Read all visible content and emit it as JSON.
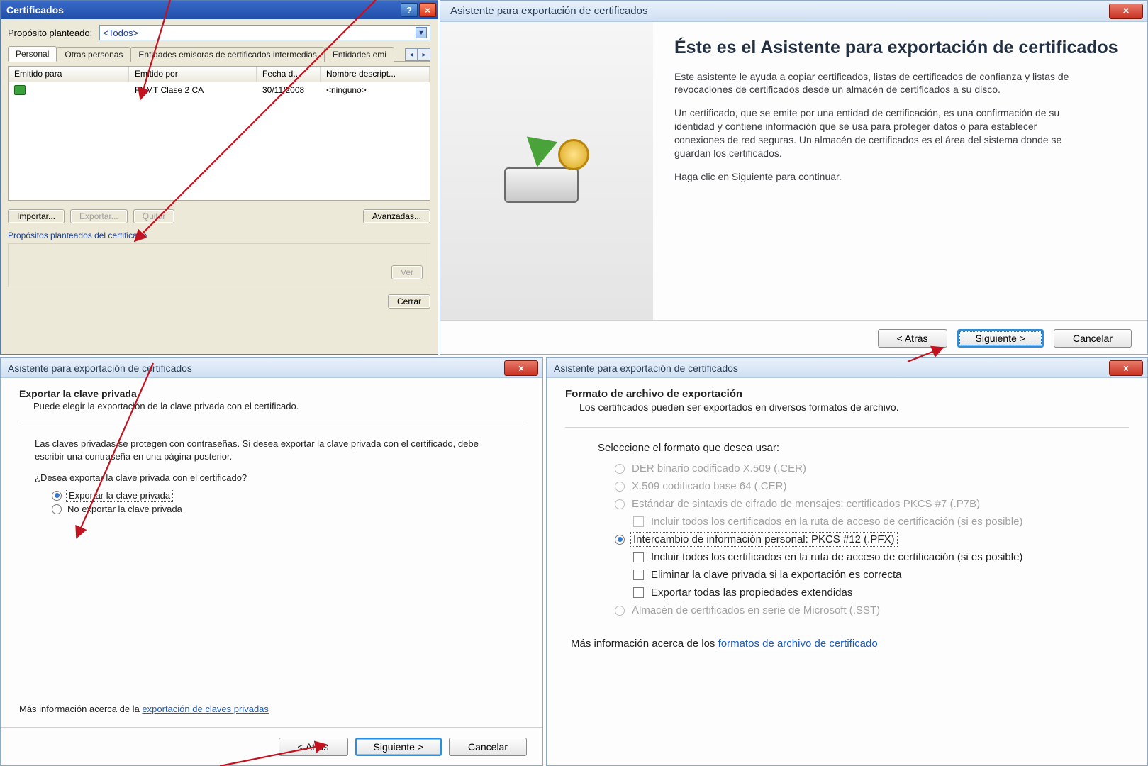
{
  "panel1": {
    "title": "Certificados",
    "purpose_label": "Propósito planteado:",
    "purpose_value": "<Todos>",
    "tabs": [
      "Personal",
      "Otras personas",
      "Entidades emisoras de certificados intermedias",
      "Entidades emi"
    ],
    "columns": [
      "Emitido para",
      "Emitido por",
      "Fecha d...",
      "Nombre descript..."
    ],
    "row": {
      "issued_to": "",
      "issued_by": "FNMT Clase 2 CA",
      "date": "30/11/2008",
      "friendly": "<ninguno>"
    },
    "btn_import": "Importar...",
    "btn_export": "Exportar...",
    "btn_remove": "Quitar",
    "btn_advanced": "Avanzadas...",
    "group_label": "Propósitos planteados del certificado",
    "btn_view": "Ver",
    "btn_close": "Cerrar"
  },
  "panel2": {
    "title": "Asistente para exportación de certificados",
    "heading": "Éste es el Asistente para exportación de certificados",
    "para1": "Este asistente le ayuda a copiar certificados, listas de certificados de confianza y listas de revocaciones de certificados desde un almacén de certificados a su disco.",
    "para2": "Un certificado, que se emite por una entidad de certificación, es una confirmación de su identidad y contiene información que se usa para proteger datos o para establecer conexiones de red seguras. Un almacén de certificados es el área del sistema donde se guardan los certificados.",
    "para3": "Haga clic en Siguiente para continuar.",
    "btn_back": "< Atrás",
    "btn_next": "Siguiente >",
    "btn_cancel": "Cancelar"
  },
  "panel3": {
    "title": "Asistente para exportación de certificados",
    "heading": "Exportar la clave privada",
    "sub": "Puede elegir la exportación de la clave privada con el certificado.",
    "para": "Las claves privadas se protegen con contraseñas. Si desea exportar la clave privada con el certificado, debe escribir una contraseña en una página posterior.",
    "question": "¿Desea exportar la clave privada con el certificado?",
    "opt_yes": "Exportar la clave privada",
    "opt_no": "No exportar la clave privada",
    "link_prefix": "Más información acerca de la ",
    "link_text": "exportación de claves privadas",
    "btn_back": "< Atrás",
    "btn_next": "Siguiente >",
    "btn_cancel": "Cancelar"
  },
  "panel4": {
    "title": "Asistente para exportación de certificados",
    "heading": "Formato de archivo de exportación",
    "sub": "Los certificados pueden ser exportados en diversos formatos de archivo.",
    "section": "Seleccione el formato que desea usar:",
    "opt_der": "DER binario codificado X.509 (.CER)",
    "opt_b64": "X.509 codificado base 64 (.CER)",
    "opt_p7b": "Estándar de sintaxis de cifrado de mensajes: certificados PKCS #7 (.P7B)",
    "opt_p7b_inc": "Incluir todos los certificados en la ruta de acceso de certificación (si es posible)",
    "opt_pfx": "Intercambio de información personal: PKCS #12 (.PFX)",
    "opt_pfx_inc": "Incluir todos los certificados en la ruta de acceso de certificación (si es posible)",
    "opt_pfx_del": "Eliminar la clave privada si la exportación es correcta",
    "opt_pfx_ext": "Exportar todas las propiedades extendidas",
    "opt_sst": "Almacén de certificados en serie de Microsoft (.SST)",
    "link_prefix": "Más información acerca de los ",
    "link_text": "formatos de archivo de certificado"
  }
}
